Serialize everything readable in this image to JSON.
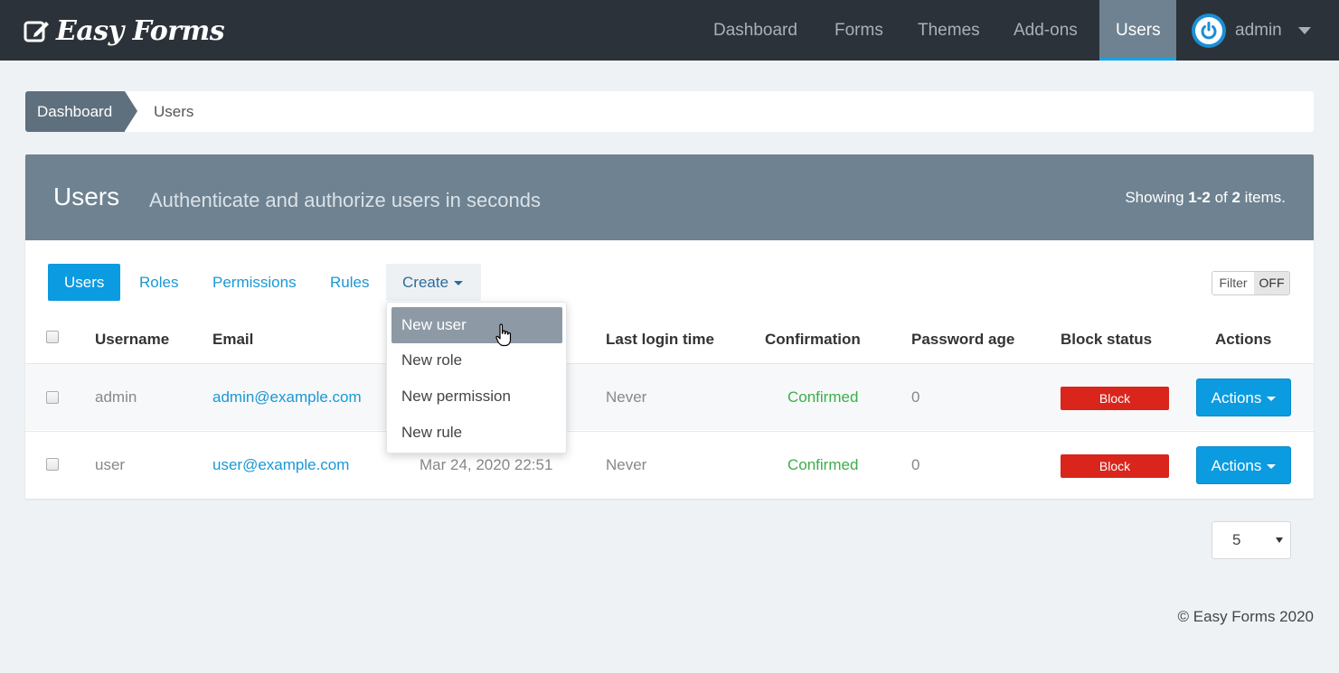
{
  "navbar": {
    "brand": "Easy Forms",
    "items": [
      {
        "label": "Dashboard"
      },
      {
        "label": "Forms"
      },
      {
        "label": "Themes"
      },
      {
        "label": "Add-ons"
      },
      {
        "label": "Users",
        "active": true
      }
    ],
    "user": "admin"
  },
  "breadcrumb": {
    "home": "Dashboard",
    "current": "Users"
  },
  "panel": {
    "title": "Users",
    "subtitle": "Authenticate and authorize users in seconds",
    "summary_prefix": "Showing ",
    "summary_range": "1-2",
    "summary_mid": " of ",
    "summary_total": "2",
    "summary_suffix": " items."
  },
  "tabs": {
    "users": "Users",
    "roles": "Roles",
    "permissions": "Permissions",
    "rules": "Rules",
    "create": "Create"
  },
  "filter": {
    "label": "Filter",
    "state": "OFF"
  },
  "table": {
    "headers": {
      "username": "Username",
      "email": "Email",
      "last_login": "Last login time",
      "confirmation": "Confirmation",
      "password_age": "Password age",
      "block_status": "Block status",
      "actions": "Actions"
    },
    "rows": [
      {
        "username": "admin",
        "email": "admin@example.com",
        "created": "",
        "last_login": "Never",
        "confirmation": "Confirmed",
        "password_age": "0",
        "block": "Block",
        "actions": "Actions"
      },
      {
        "username": "user",
        "email": "user@example.com",
        "created": "Mar 24, 2020 22:51",
        "last_login": "Never",
        "confirmation": "Confirmed",
        "password_age": "0",
        "block": "Block",
        "actions": "Actions"
      }
    ]
  },
  "create_menu": {
    "items": [
      "New user",
      "New role",
      "New permission",
      "New rule"
    ],
    "hovered": "New user"
  },
  "page_size": {
    "value": "5"
  },
  "footer": {
    "text": "© Easy Forms 2020"
  },
  "colors": {
    "navbar_bg": "#2c3239",
    "accent": "#0b9be0",
    "panel_head": "#6e8291",
    "danger": "#d9251c",
    "success": "#3cae4a"
  },
  "icons": {
    "brand": "edit-square-icon",
    "avatar": "power-icon",
    "cursor": "hand-pointer-icon"
  }
}
